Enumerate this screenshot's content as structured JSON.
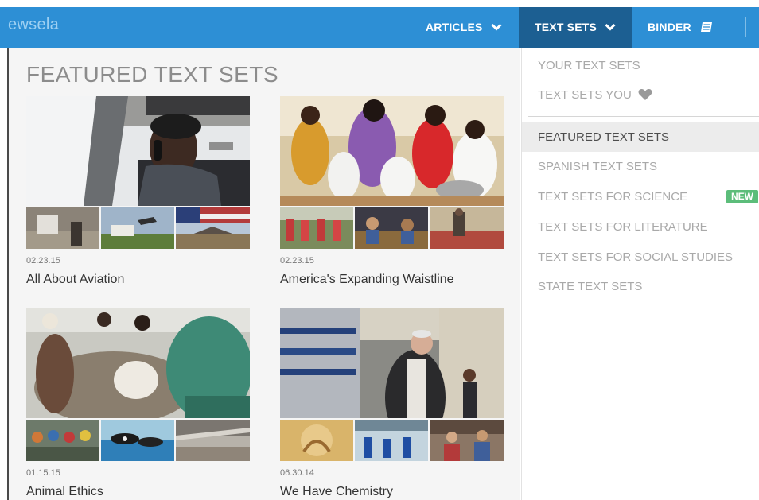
{
  "nav": {
    "brand": "ewsela",
    "articles_label": "ARTICLES",
    "textsets_label": "TEXT SETS",
    "binder_label": "BINDER",
    "colors": {
      "bar": "#2d8fd5",
      "active": "#1c5f92"
    }
  },
  "main": {
    "title": "FEATURED TEXT SETS",
    "cards": [
      {
        "date": "02.23.15",
        "title": "All About Aviation"
      },
      {
        "date": "02.23.15",
        "title": "America's Expanding Waistline"
      },
      {
        "date": "01.15.15",
        "title": "Animal Ethics"
      },
      {
        "date": "06.30.14",
        "title": "We Have Chemistry"
      }
    ]
  },
  "dropdown": {
    "items": [
      {
        "label": "YOUR TEXT SETS"
      },
      {
        "label": "TEXT SETS YOU",
        "icon": "heart-icon"
      },
      {
        "label": "FEATURED TEXT SETS",
        "active": true
      },
      {
        "label": "SPANISH TEXT SETS"
      },
      {
        "label": "TEXT SETS FOR SCIENCE",
        "badge": "NEW"
      },
      {
        "label": "TEXT SETS FOR LITERATURE"
      },
      {
        "label": "TEXT SETS FOR SOCIAL STUDIES"
      },
      {
        "label": "STATE TEXT SETS"
      }
    ],
    "colors": {
      "badge": "#5cbd7a"
    }
  }
}
